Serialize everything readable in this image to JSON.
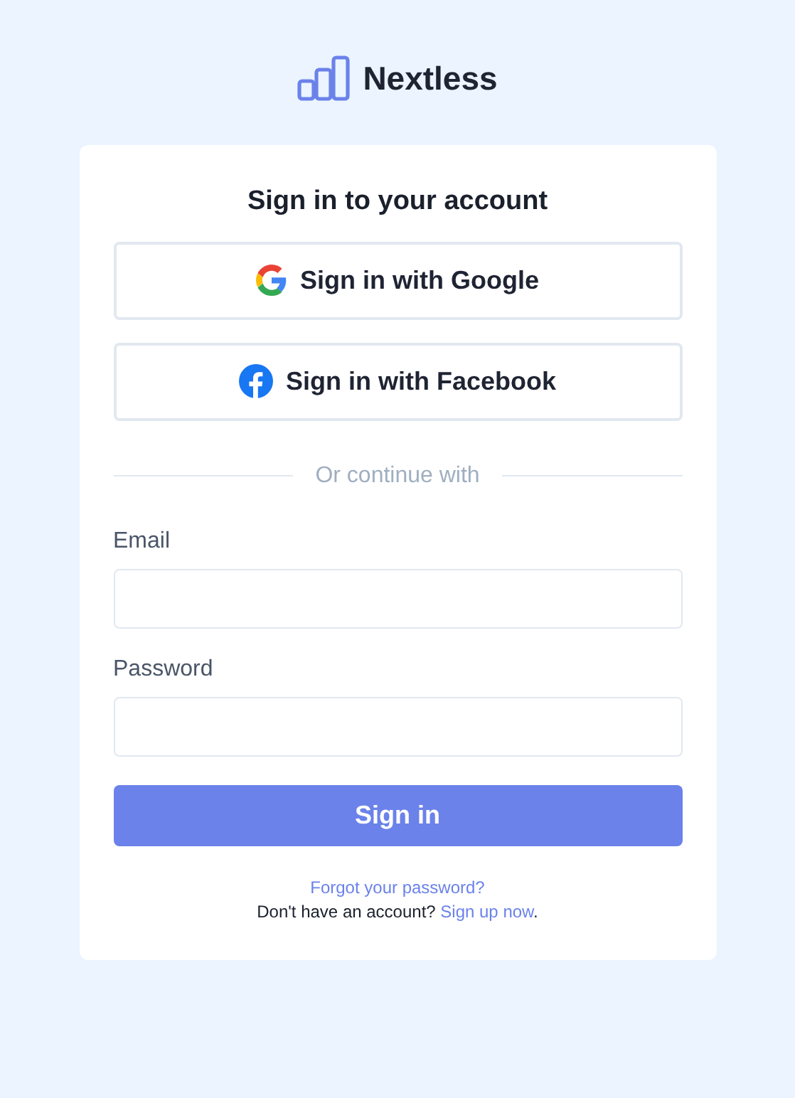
{
  "brand": {
    "name": "Nextless"
  },
  "card": {
    "title": "Sign in to your account",
    "social_buttons": [
      {
        "kind": "google",
        "label": "Sign in with Google"
      },
      {
        "kind": "facebook",
        "label": "Sign in with Facebook"
      }
    ],
    "divider": "Or continue with",
    "fields": [
      {
        "label": "Email"
      },
      {
        "label": "Password"
      }
    ],
    "submit": "Sign in",
    "forgot_link": "Forgot your password?",
    "signup": {
      "prompt": "Don't have an account?",
      "link": "Sign up now",
      "end": "."
    }
  }
}
